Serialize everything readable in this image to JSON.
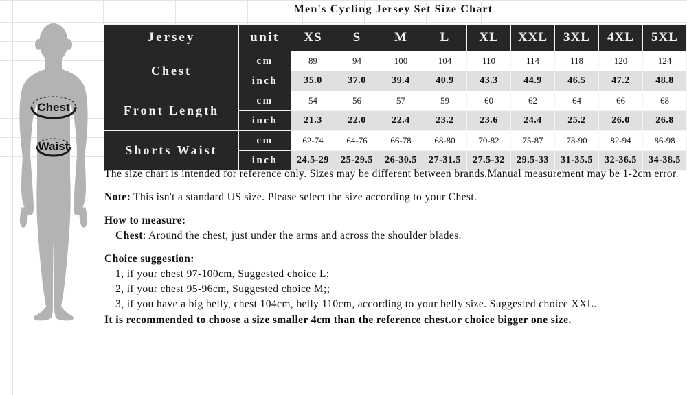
{
  "title": "Men's Cycling Jersey Set Size Chart",
  "figure": {
    "chest_label": "Chest",
    "waist_label": "Waist",
    "silhouette": "male-body-silhouette"
  },
  "table": {
    "header": [
      "Jersey",
      "unit",
      "XS",
      "S",
      "M",
      "L",
      "XL",
      "XXL",
      "3XL",
      "4XL",
      "5XL"
    ],
    "row_labels": [
      "Chest",
      "Front Length",
      "Shorts Waist"
    ],
    "units": [
      "cm",
      "inch"
    ],
    "rows": [
      {
        "label": "Chest",
        "cm": [
          "89",
          "94",
          "100",
          "104",
          "110",
          "114",
          "118",
          "120",
          "124"
        ],
        "inch": [
          "35.0",
          "37.0",
          "39.4",
          "40.9",
          "43.3",
          "44.9",
          "46.5",
          "47.2",
          "48.8"
        ]
      },
      {
        "label": "Front Length",
        "cm": [
          "54",
          "56",
          "57",
          "59",
          "60",
          "62",
          "64",
          "66",
          "68"
        ],
        "inch": [
          "21.3",
          "22.0",
          "22.4",
          "23.2",
          "23.6",
          "24.4",
          "25.2",
          "26.0",
          "26.8"
        ]
      },
      {
        "label": "Shorts Waist",
        "cm": [
          "62-74",
          "64-76",
          "66-78",
          "68-80",
          "70-82",
          "75-87",
          "78-90",
          "82-94",
          "86-98"
        ],
        "inch": [
          "24.5-29",
          "25-29.5",
          "26-30.5",
          "27-31.5",
          "27.5-32",
          "29.5-33",
          "31-35.5",
          "32-36.5",
          "34-38.5"
        ]
      }
    ]
  },
  "notes": {
    "disclaimer": "The size chart is intended for reference only. Sizes may be different between brands.Manual measurement may be 1-2cm error.",
    "note_label": "Note:",
    "note_text": " This isn't a standard US size. Please select the size according to your Chest.",
    "how_to_measure_heading": "How to measure:",
    "chest_label": "Chest",
    "chest_method": ": Around the chest, just under the arms and across the shoulder blades.",
    "choice_heading": "Choice suggestion:",
    "choice_items": [
      "1, if your chest 97-100cm, Suggested choice L;",
      "2, if your chest 95-96cm, Suggested choice M;;",
      "3, if you have a big belly, chest 104cm, belly 110cm, according to your belly size. Suggested choice XXL."
    ],
    "final_recommendation": "It is recommended to choose a size smaller 4cm than the reference chest.or choice bigger one size."
  },
  "colors": {
    "header_bg": "#262626",
    "header_text": "#f2f2f2",
    "cm_row_bg": "#ffffff",
    "inch_row_bg": "#e0e0e0",
    "silhouette": "#b3b3b3",
    "gridline": "#e4e4e4"
  }
}
